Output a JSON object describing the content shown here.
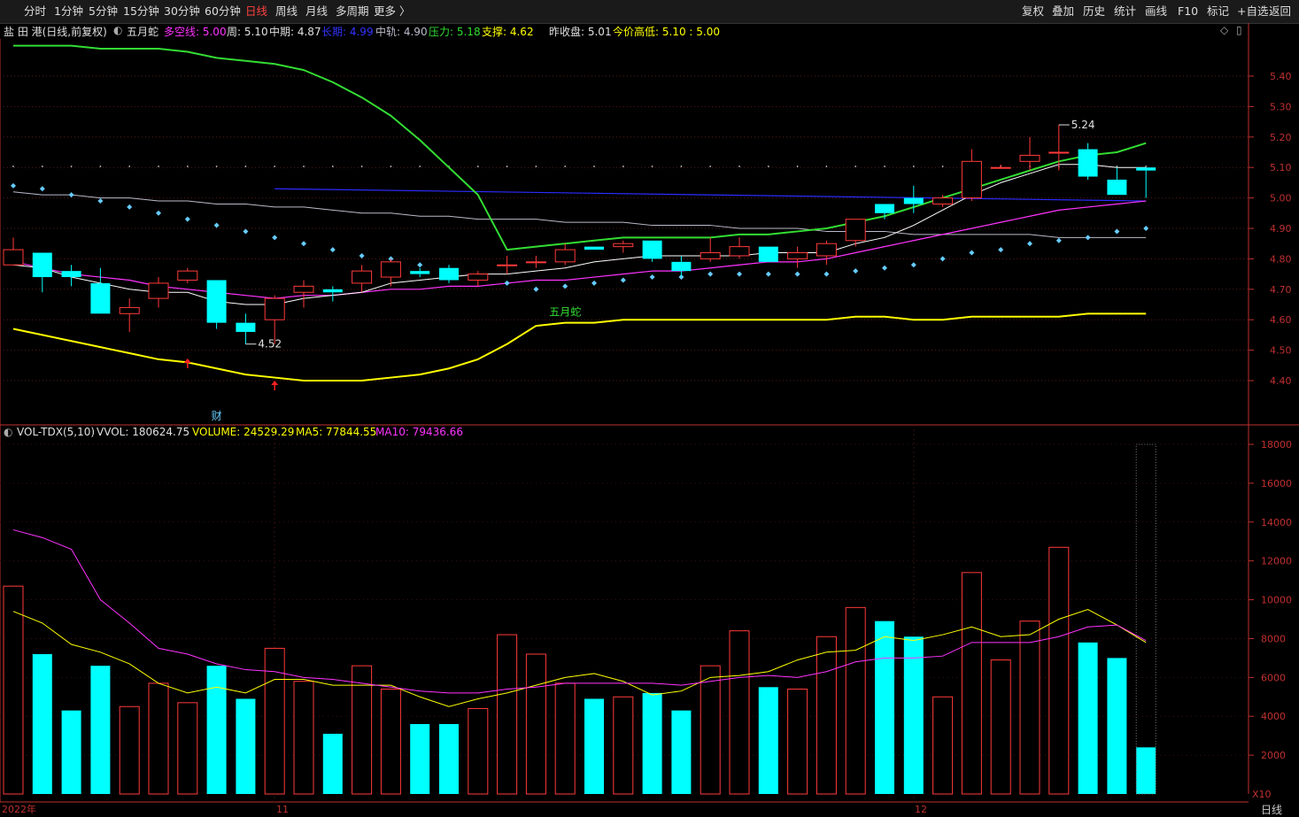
{
  "toolbar": {
    "left": [
      "分时",
      "1分钟",
      "5分钟",
      "15分钟",
      "30分钟",
      "60分钟",
      "日线",
      "周线",
      "月线",
      "多周期",
      "更多 〉"
    ],
    "active": "日线",
    "right": [
      "复权",
      "叠加",
      "历史",
      "统计",
      "画线",
      "F10",
      "标记",
      "+自选",
      "返回"
    ]
  },
  "info": {
    "name": "盐 田 港(日线,前复权)",
    "indicator": "五月蛇",
    "duokong": "多空线: 5.00",
    "week": "周: 5.10",
    "mid": "中期: 4.87",
    "long": "长期: 4.99",
    "zhonggui": "中轨: 4.90",
    "pressure": "压力: 5.18",
    "support": "支撑: 4.62",
    "prev_close": "昨收盘: 5.01",
    "hilo": "今价高低: 5.10 : 5.00"
  },
  "vol_info": {
    "name": "VOL-TDX(5,10)",
    "vvol": "VVOL: 180624.75",
    "volume": "VOLUME: 24529.29",
    "ma5": "MA5: 77844.55",
    "ma10": "MA10: 79436.66"
  },
  "colors": {
    "up": "#ff3a3a",
    "down": "#00ffff",
    "axis": "#c03030",
    "green": "#33dd33",
    "yellow": "#ffff00",
    "magenta": "#ff33ff",
    "blue": "#2c2cff",
    "grey": "#bbbbcc"
  },
  "labels": {
    "max": "5.24",
    "min": "4.52",
    "signal": "五月蛇",
    "cai": "财",
    "x10": "X10",
    "period": "日线"
  },
  "chart_data": [
    {
      "type": "candlestick",
      "ylim": [
        4.3,
        5.48
      ],
      "yticks": [
        4.4,
        4.5,
        4.6,
        4.7,
        4.8,
        4.9,
        5.0,
        5.1,
        5.2,
        5.3,
        5.4
      ],
      "ohlc": [
        [
          4.78,
          4.87,
          4.78,
          4.83
        ],
        [
          4.82,
          4.82,
          4.69,
          4.74
        ],
        [
          4.76,
          4.78,
          4.71,
          4.74
        ],
        [
          4.72,
          4.77,
          4.62,
          4.62
        ],
        [
          4.62,
          4.67,
          4.56,
          4.64
        ],
        [
          4.67,
          4.74,
          4.64,
          4.72
        ],
        [
          4.73,
          4.77,
          4.72,
          4.76
        ],
        [
          4.73,
          4.73,
          4.57,
          4.59
        ],
        [
          4.59,
          4.62,
          4.52,
          4.56
        ],
        [
          4.6,
          4.68,
          4.52,
          4.67
        ],
        [
          4.69,
          4.73,
          4.64,
          4.71
        ],
        [
          4.7,
          4.71,
          4.66,
          4.69
        ],
        [
          4.72,
          4.78,
          4.69,
          4.76
        ],
        [
          4.74,
          4.8,
          4.71,
          4.79
        ],
        [
          4.76,
          4.77,
          4.74,
          4.75
        ],
        [
          4.77,
          4.78,
          4.72,
          4.73
        ],
        [
          4.73,
          4.76,
          4.71,
          4.75
        ],
        [
          4.78,
          4.81,
          4.75,
          4.78
        ],
        [
          4.79,
          4.81,
          4.77,
          4.79
        ],
        [
          4.79,
          4.85,
          4.78,
          4.83
        ],
        [
          4.84,
          4.84,
          4.83,
          4.83
        ],
        [
          4.84,
          4.86,
          4.82,
          4.85
        ],
        [
          4.86,
          4.86,
          4.79,
          4.8
        ],
        [
          4.79,
          4.81,
          4.74,
          4.76
        ],
        [
          4.8,
          4.87,
          4.79,
          4.82
        ],
        [
          4.81,
          4.87,
          4.8,
          4.84
        ],
        [
          4.84,
          4.84,
          4.79,
          4.79
        ],
        [
          4.8,
          4.84,
          4.77,
          4.82
        ],
        [
          4.81,
          4.86,
          4.78,
          4.85
        ],
        [
          4.86,
          4.93,
          4.84,
          4.93
        ],
        [
          4.98,
          4.98,
          4.93,
          4.95
        ],
        [
          5.0,
          5.04,
          4.95,
          4.98
        ],
        [
          4.98,
          5.01,
          4.97,
          5.0
        ],
        [
          5.0,
          5.16,
          4.99,
          5.12
        ],
        [
          5.1,
          5.11,
          5.1,
          5.1
        ],
        [
          5.12,
          5.2,
          5.09,
          5.14
        ],
        [
          5.15,
          5.24,
          5.09,
          5.15
        ],
        [
          5.16,
          5.18,
          5.06,
          5.07
        ],
        [
          5.06,
          5.1,
          5.01,
          5.01
        ],
        [
          5.1,
          5.1,
          5.0,
          5.09
        ]
      ],
      "lines": {
        "pressure": [
          5.5,
          5.5,
          5.5,
          5.49,
          5.49,
          5.49,
          5.48,
          5.46,
          5.45,
          5.44,
          5.42,
          5.38,
          5.33,
          5.27,
          5.19,
          5.1,
          5.01,
          4.83,
          4.84,
          4.85,
          4.86,
          4.87,
          4.87,
          4.87,
          4.87,
          4.88,
          4.88,
          4.89,
          4.9,
          4.92,
          4.94,
          4.97,
          5.0,
          5.03,
          5.06,
          5.09,
          5.12,
          5.14,
          5.15,
          5.18
        ],
        "support": [
          4.57,
          4.55,
          4.53,
          4.51,
          4.49,
          4.47,
          4.46,
          4.44,
          4.42,
          4.41,
          4.4,
          4.4,
          4.4,
          4.41,
          4.42,
          4.44,
          4.47,
          4.52,
          4.58,
          4.59,
          4.59,
          4.6,
          4.6,
          4.6,
          4.6,
          4.6,
          4.6,
          4.6,
          4.6,
          4.61,
          4.61,
          4.6,
          4.6,
          4.61,
          4.61,
          4.61,
          4.61,
          4.62,
          4.62,
          4.62
        ],
        "mid": [
          4.79,
          4.77,
          4.75,
          4.74,
          4.73,
          4.71,
          4.7,
          4.69,
          4.68,
          4.67,
          4.68,
          4.68,
          4.69,
          4.7,
          4.7,
          4.71,
          4.71,
          4.72,
          4.73,
          4.73,
          4.74,
          4.75,
          4.76,
          4.76,
          4.77,
          4.78,
          4.79,
          4.79,
          4.8,
          4.82,
          4.84,
          4.86,
          4.88,
          4.9,
          4.92,
          4.94,
          4.96,
          4.97,
          4.98,
          4.99
        ],
        "short": [
          4.78,
          4.77,
          4.74,
          4.72,
          4.7,
          4.69,
          4.69,
          4.66,
          4.65,
          4.65,
          4.67,
          4.68,
          4.69,
          4.72,
          4.73,
          4.74,
          4.75,
          4.75,
          4.76,
          4.77,
          4.79,
          4.8,
          4.81,
          4.81,
          4.81,
          4.81,
          4.82,
          4.82,
          4.82,
          4.85,
          4.87,
          4.91,
          4.96,
          5.01,
          5.05,
          5.08,
          5.11,
          5.11,
          5.1,
          5.1
        ],
        "grey": [
          5.02,
          5.01,
          5.01,
          5.0,
          5.0,
          4.99,
          4.99,
          4.98,
          4.98,
          4.97,
          4.97,
          4.96,
          4.95,
          4.95,
          4.94,
          4.94,
          4.93,
          4.93,
          4.93,
          4.92,
          4.92,
          4.92,
          4.91,
          4.91,
          4.91,
          4.9,
          4.9,
          4.9,
          4.89,
          4.89,
          4.89,
          4.88,
          4.88,
          4.88,
          4.88,
          4.88,
          4.87,
          4.87,
          4.87,
          4.87
        ],
        "blue": {
          "start": 9,
          "value": 5.03,
          "end_value": 4.99
        },
        "dots": [
          5.04,
          5.03,
          5.01,
          4.99,
          4.97,
          4.95,
          4.93,
          4.91,
          4.89,
          4.87,
          4.85,
          4.83,
          4.81,
          4.8,
          4.78,
          4.76,
          4.74,
          4.72,
          4.7,
          4.71,
          4.72,
          4.73,
          4.74,
          4.74,
          4.75,
          4.75,
          4.75,
          4.75,
          4.75,
          4.76,
          4.77,
          4.78,
          4.8,
          4.82,
          4.83,
          4.85,
          4.86,
          4.87,
          4.89,
          4.9
        ]
      }
    },
    {
      "type": "bar",
      "ylim": [
        0,
        19000
      ],
      "yticks": [
        2000,
        4000,
        6000,
        8000,
        10000,
        12000,
        14000,
        16000,
        18000
      ],
      "volume": [
        10700,
        7200,
        4300,
        6600,
        4500,
        5700,
        4700,
        6600,
        4900,
        7500,
        5800,
        3100,
        6600,
        5400,
        3600,
        3600,
        4400,
        8200,
        7200,
        5700,
        4900,
        5000,
        5200,
        4300,
        6600,
        8400,
        5500,
        5400,
        8100,
        9600,
        8900,
        8100,
        5000,
        11400,
        6900,
        8900,
        12700,
        7800,
        7000,
        2400
      ],
      "volume_ghost": 18000,
      "ma5": [
        9400,
        8800,
        7700,
        7300,
        6700,
        5700,
        5200,
        5500,
        5200,
        5900,
        5900,
        5600,
        5600,
        5600,
        5000,
        4500,
        4900,
        5200,
        5600,
        6000,
        6200,
        5800,
        5100,
        5300,
        6000,
        6100,
        6300,
        6900,
        7300,
        7400,
        8100,
        7900,
        8200,
        8600,
        8100,
        8200,
        9000,
        9500,
        8700,
        7800
      ],
      "ma10": [
        13600,
        13200,
        12600,
        10000,
        8800,
        7500,
        7200,
        6700,
        6400,
        6300,
        6000,
        5900,
        5700,
        5500,
        5300,
        5200,
        5200,
        5400,
        5500,
        5700,
        5700,
        5700,
        5700,
        5600,
        5800,
        6000,
        6100,
        6000,
        6300,
        6800,
        7000,
        7000,
        7100,
        7800,
        7800,
        7800,
        8100,
        8600,
        8700,
        7900
      ]
    }
  ]
}
